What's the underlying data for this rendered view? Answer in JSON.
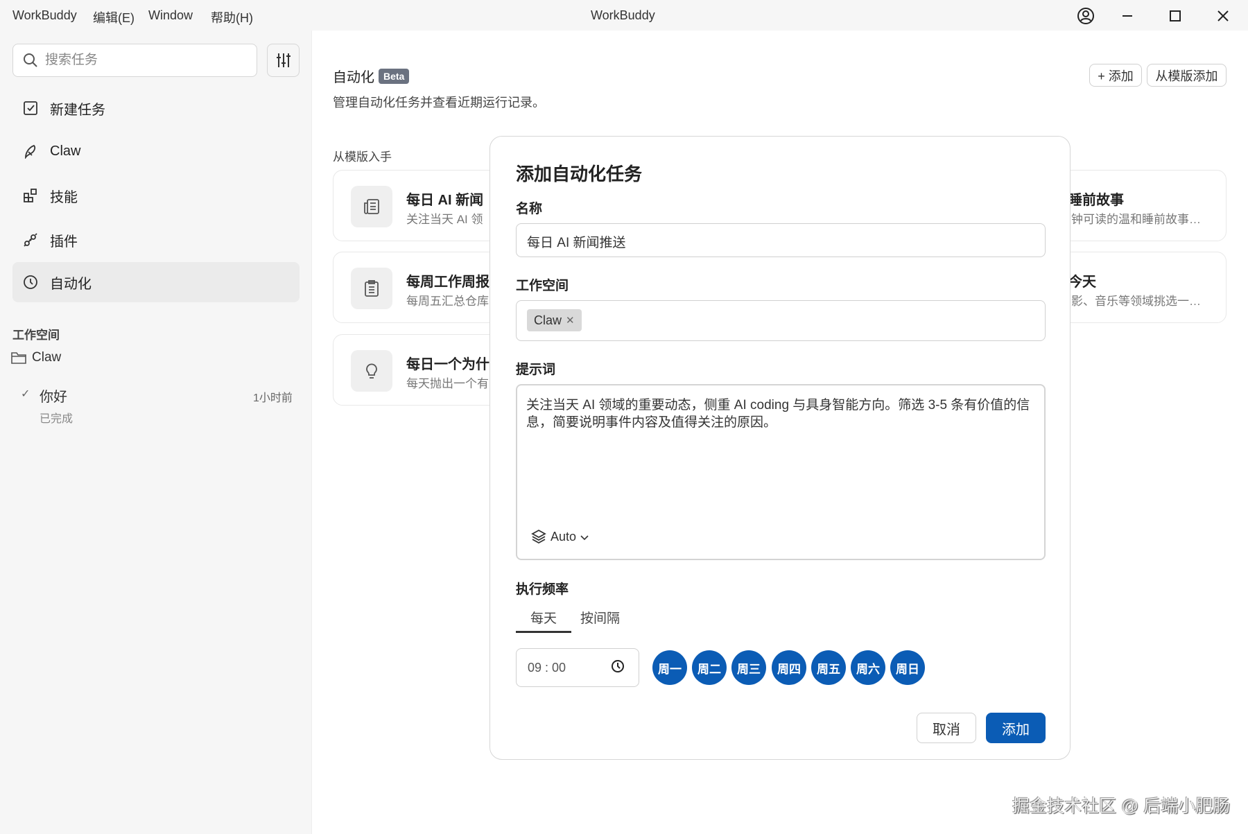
{
  "titlebar": {
    "app_menu": "WorkBuddy",
    "menus": [
      "编辑(E)",
      "Window",
      "帮助(H)"
    ],
    "title": "WorkBuddy"
  },
  "sidebar": {
    "search_placeholder": "搜索任务",
    "nav": [
      {
        "label": "新建任务",
        "icon": "checkbox-icon"
      },
      {
        "label": "Claw",
        "icon": "claw-icon"
      },
      {
        "label": "技能",
        "icon": "skills-icon"
      },
      {
        "label": "插件",
        "icon": "plug-icon"
      },
      {
        "label": "自动化",
        "icon": "clock-icon",
        "selected": true
      }
    ],
    "workspace_heading": "工作空间",
    "workspace": "Claw",
    "task": {
      "name": "你好",
      "status": "已完成",
      "time": "1小时前"
    }
  },
  "main": {
    "title": "自动化",
    "badge": "Beta",
    "subtitle": "管理自动化任务并查看近期运行记录。",
    "add_button": "+ 添加",
    "template_button": "从模版添加",
    "templates_heading": "从模版入手",
    "templates": [
      {
        "title": "每日 AI 新闻",
        "desc": "关注当天 AI 领"
      },
      {
        "title": "每周工作周报",
        "desc": "每周五汇总仓库"
      },
      {
        "title": "每日一个为什么",
        "desc": "每天抛出一个有"
      },
      {
        "title": "睡前故事",
        "desc": "钟可读的温和睡前故事…"
      },
      {
        "title": "今天",
        "desc": "影、音乐等领域挑选一…"
      }
    ]
  },
  "dialog": {
    "title": "添加自动化任务",
    "name_label": "名称",
    "name_value": "每日 AI 新闻推送",
    "workspace_label": "工作空间",
    "workspace_chip": "Claw",
    "prompt_label": "提示词",
    "prompt_value": "关注当天 AI 领域的重要动态，侧重 AI coding 与具身智能方向。筛选 3-5 条有价值的信息，简要说明事件内容及值得关注的原因。",
    "model": "Auto",
    "frequency_label": "执行频率",
    "tabs": [
      "每天",
      "按间隔"
    ],
    "active_tab": "每天",
    "time": "09 : 00",
    "days": [
      "周一",
      "周二",
      "周三",
      "周四",
      "周五",
      "周六",
      "周日"
    ],
    "accent": "#0b5cb5",
    "cancel": "取消",
    "submit": "添加"
  },
  "watermark": "掘金技术社区 @ 后端小肥肠"
}
